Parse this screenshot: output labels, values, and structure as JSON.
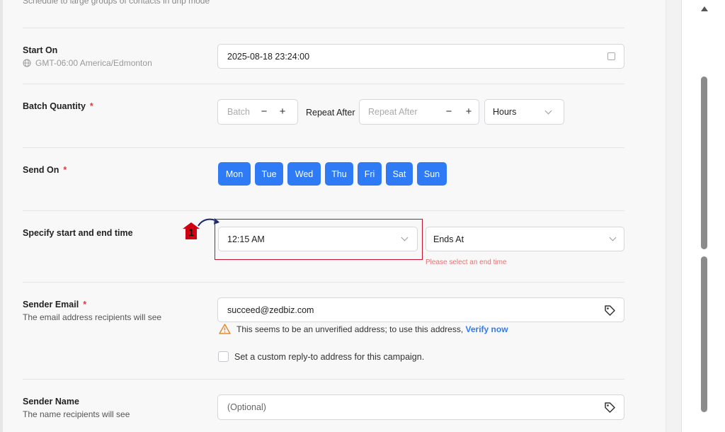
{
  "header": {
    "subtitle": "Schedule to large groups of contacts in drip mode"
  },
  "start_on": {
    "label": "Start On",
    "timezone": "GMT-06:00 America/Edmonton",
    "value": "2025-08-18 23:24:00"
  },
  "batch": {
    "label": "Batch Quantity",
    "required_mark": "*",
    "batch_placeholder": "Batch Q",
    "minus": "−",
    "plus": "+",
    "repeat_label": "Repeat After",
    "repeat_placeholder": "Repeat After",
    "unit_value": "Hours"
  },
  "send_on": {
    "label": "Send On",
    "required_mark": "*",
    "days": [
      "Mon",
      "Tue",
      "Wed",
      "Thu",
      "Fri",
      "Sat",
      "Sun"
    ]
  },
  "time_range": {
    "label": "Specify start and end time",
    "start_value": "12:15 AM",
    "end_placeholder": "Ends At",
    "error": "Please select an end time"
  },
  "callout": {
    "number": "1"
  },
  "sender_email": {
    "label": "Sender Email",
    "required_mark": "*",
    "description": "The email address recipients will see",
    "value": "succeed@zedbiz.com",
    "warning": "This seems to be an unverified address; to use this address,",
    "verify_link": "Verify now",
    "reply_to_label": "Set a custom reply-to address for this campaign."
  },
  "sender_name": {
    "label": "Sender Name",
    "description": "The name recipients will see",
    "placeholder": "(Optional)"
  },
  "colors": {
    "accent": "#2f7bf5",
    "highlight": "#c8102e",
    "error": "#e47373",
    "warning": "#e8882c"
  }
}
